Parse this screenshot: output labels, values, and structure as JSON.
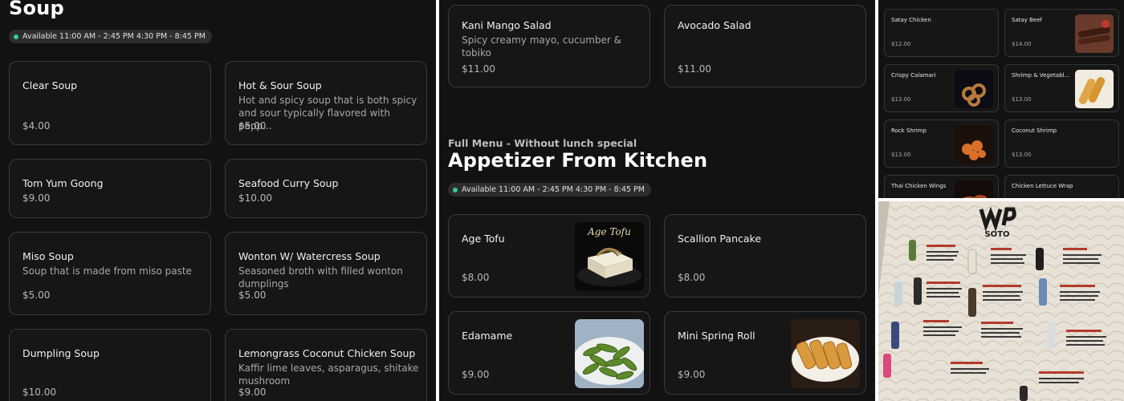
{
  "soup_panel": {
    "title": "Soup",
    "availability": "Available 11:00 AM - 2:45 PM 4:30 PM - 8:45 PM",
    "items": [
      {
        "name": "Clear Soup",
        "desc": "",
        "price": "$4.00"
      },
      {
        "name": "Hot & Sour Soup",
        "desc": "Hot and spicy soup that is both spicy and sour typically flavored with pepp...",
        "price": "$5.00"
      },
      {
        "name": "Tom Yum Goong",
        "desc": "",
        "price": "$9.00"
      },
      {
        "name": "Seafood Curry Soup",
        "desc": "",
        "price": "$10.00"
      },
      {
        "name": "Miso Soup",
        "desc": "Soup that is made from miso paste",
        "price": "$5.00"
      },
      {
        "name": "Wonton W/ Watercress Soup",
        "desc": "Seasoned broth with filled wonton dumplings",
        "price": "$5.00"
      },
      {
        "name": "Dumpling Soup",
        "desc": "",
        "price": "$10.00"
      },
      {
        "name": "Lemongrass Coconut Chicken Soup",
        "desc": "Kaffir lime leaves, asparagus, shitake mushroom",
        "price": "$9.00"
      }
    ]
  },
  "kitchen_panel": {
    "salads": [
      {
        "name": "Kani Mango Salad",
        "desc": "Spicy creamy mayo, cucumber & tobiko",
        "price": "$11.00"
      },
      {
        "name": "Avocado Salad",
        "desc": "",
        "price": "$11.00"
      }
    ],
    "subtitle": "Full Menu - Without lunch special",
    "title": "Appetizer From Kitchen",
    "availability": "Available 11:00 AM - 2:45 PM 4:30 PM - 8:45 PM",
    "items": [
      {
        "name": "Age Tofu",
        "price": "$8.00",
        "image_caption": "Age Tofu"
      },
      {
        "name": "Scallion Pancake",
        "price": "$8.00"
      },
      {
        "name": "Edamame",
        "price": "$9.00"
      },
      {
        "name": "Mini Spring Roll",
        "price": "$9.00"
      }
    ]
  },
  "small_panel": {
    "items": [
      {
        "name": "Satay Chicken",
        "price": "$12.00"
      },
      {
        "name": "Satay Beef",
        "price": "$14.00"
      },
      {
        "name": "Crispy Calamari",
        "price": "$13.00"
      },
      {
        "name": "Shrimp & Vegetabl...",
        "price": "$13.00"
      },
      {
        "name": "Rock Shrimp",
        "price": "$13.00"
      },
      {
        "name": "Coconut Shrimp",
        "price": "$13.00"
      },
      {
        "name": "Thai Chicken Wings",
        "price": ""
      },
      {
        "name": "Chicken Lettuce Wrap",
        "price": ""
      }
    ]
  },
  "sake_menu": {
    "brand": "SOTO"
  },
  "colors": {
    "background": "#121212",
    "card_border": "#3a3a3a",
    "availability_dot": "#2fcf8f"
  }
}
